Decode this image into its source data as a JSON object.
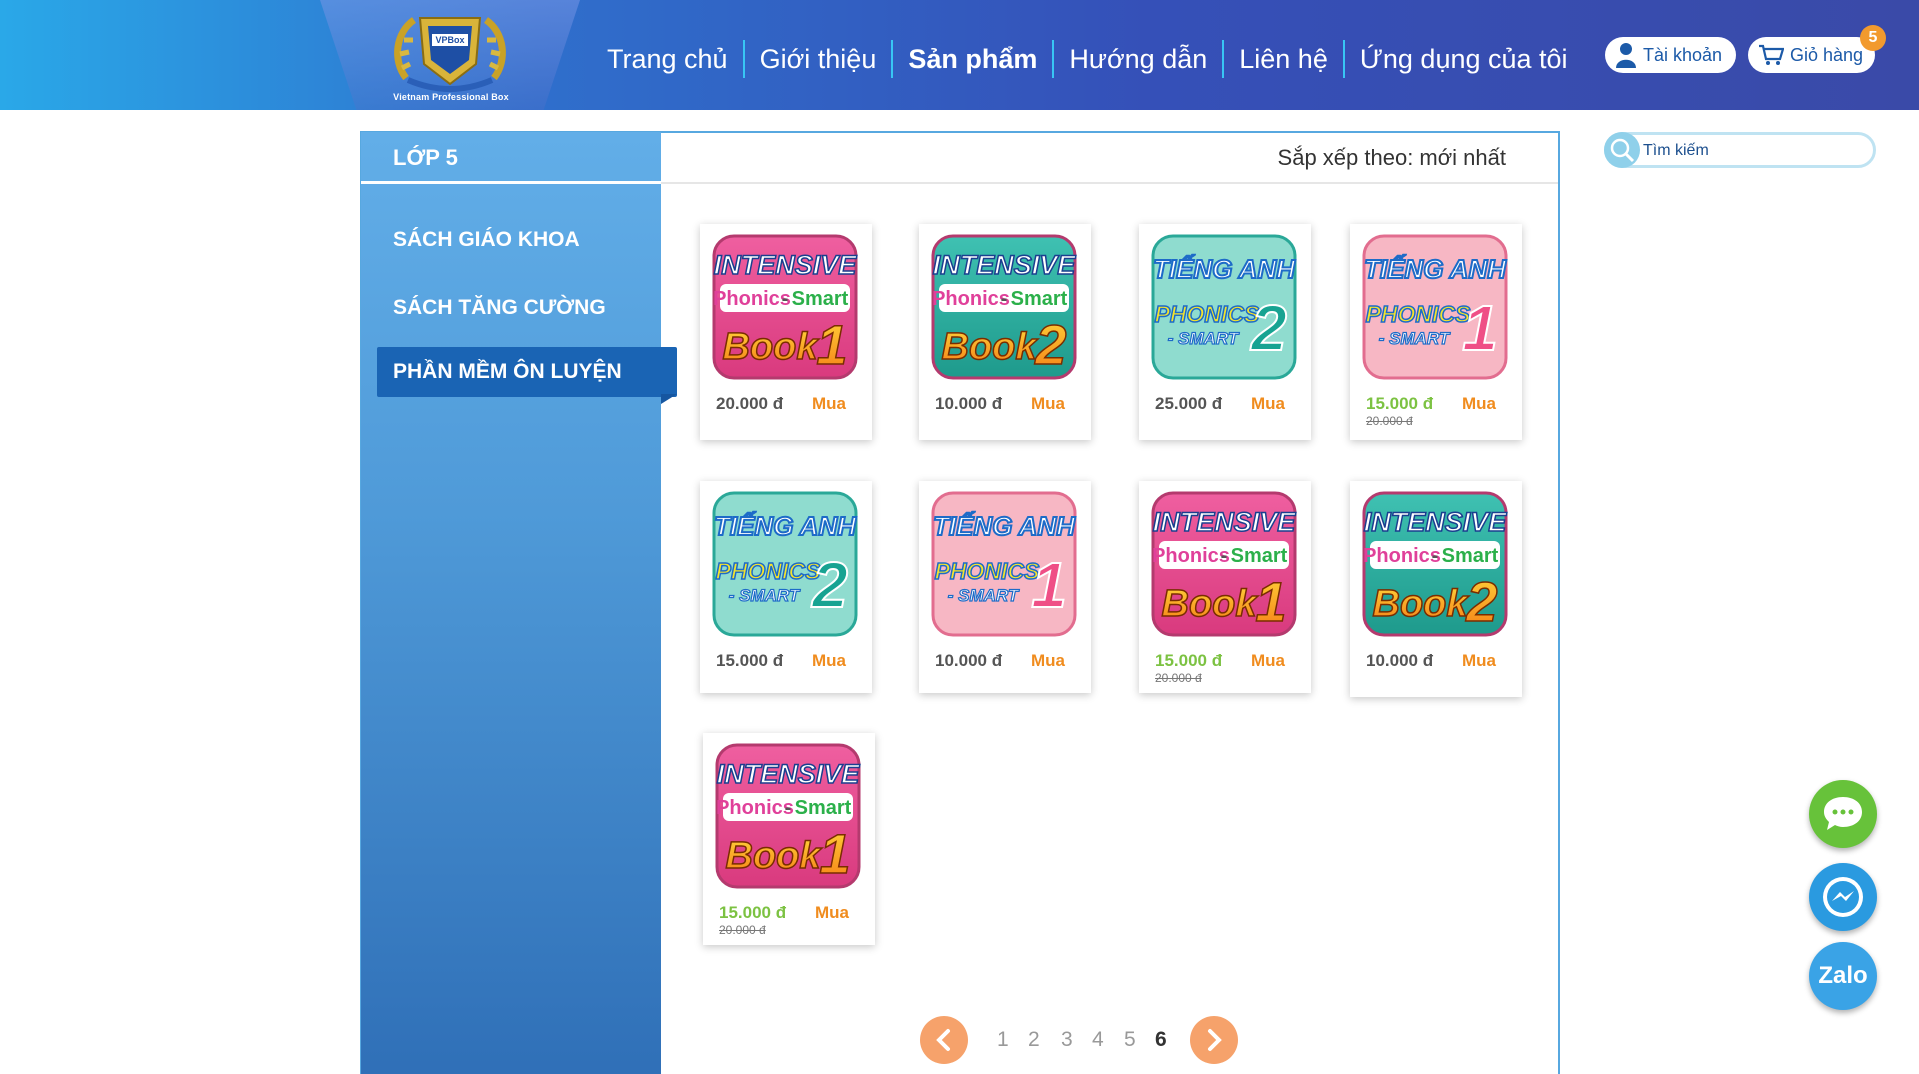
{
  "brand": {
    "logo_text": "VPBox",
    "caption": "Vietnam Professional Box"
  },
  "nav": [
    {
      "label": "Trang chủ"
    },
    {
      "label": "Giới thiệu"
    },
    {
      "label": "Sản phẩm",
      "active": true
    },
    {
      "label": "Hướng dẫn"
    },
    {
      "label": "Liên hệ"
    },
    {
      "label": "Ứng dụng của tôi"
    }
  ],
  "account": {
    "label": "Tài khoản",
    "icon": "user-icon"
  },
  "cart": {
    "label": "Giỏ hàng",
    "count": "5",
    "icon": "cart-icon"
  },
  "sidebar": {
    "title": "LỚP 5",
    "items": [
      "SÁCH GIÁO KHOA",
      "SÁCH TĂNG CƯỜNG",
      "PHẦN MỀM ÔN LUYỆN"
    ],
    "active_index": 2
  },
  "sort": {
    "label": "Sắp xếp theo: mới nhất"
  },
  "search": {
    "placeholder": "Tìm kiếm",
    "icon": "search-icon"
  },
  "products": [
    {
      "icon": "intensive-book1",
      "price": "20.000 đ",
      "buy": "Mua"
    },
    {
      "icon": "intensive-book2",
      "price": "10.000 đ",
      "buy": "Mua"
    },
    {
      "icon": "tienganh-2",
      "price": "25.000 đ",
      "buy": "Mua"
    },
    {
      "icon": "tienganh-1",
      "price": "15.000 đ",
      "old_price": "20.000 đ",
      "buy": "Mua"
    },
    {
      "icon": "tienganh-2",
      "price": "15.000 đ",
      "buy": "Mua"
    },
    {
      "icon": "tienganh-1",
      "price": "10.000 đ",
      "buy": "Mua"
    },
    {
      "icon": "intensive-book1",
      "price": "15.000 đ",
      "old_price": "20.000 đ",
      "buy": "Mua"
    },
    {
      "icon": "intensive-book2",
      "price": "10.000 đ",
      "buy": "Mua"
    },
    {
      "icon": "intensive-book1",
      "price": "15.000 đ",
      "old_price": "20.000 đ",
      "buy": "Mua"
    }
  ],
  "icon_text": {
    "intensive": "INTENSIVE",
    "phonics": "Phonics",
    "smart": "Smart",
    "book": "Book",
    "tienganh": "TIẾNG ANH",
    "phonics_caps": "PHONICS",
    "smart_caps": "- SMART"
  },
  "pagination": {
    "pages": [
      "1",
      "2",
      "3",
      "4",
      "5",
      "6"
    ],
    "current": "6"
  },
  "floating": {
    "chat": "chat-icon",
    "messenger": "messenger-icon",
    "zalo": "Zalo"
  },
  "colors": {
    "accent": "#f08c1e",
    "sale": "#7cc242",
    "nav_active_bg": "#1a64b4",
    "badge": "#f29a2e"
  }
}
